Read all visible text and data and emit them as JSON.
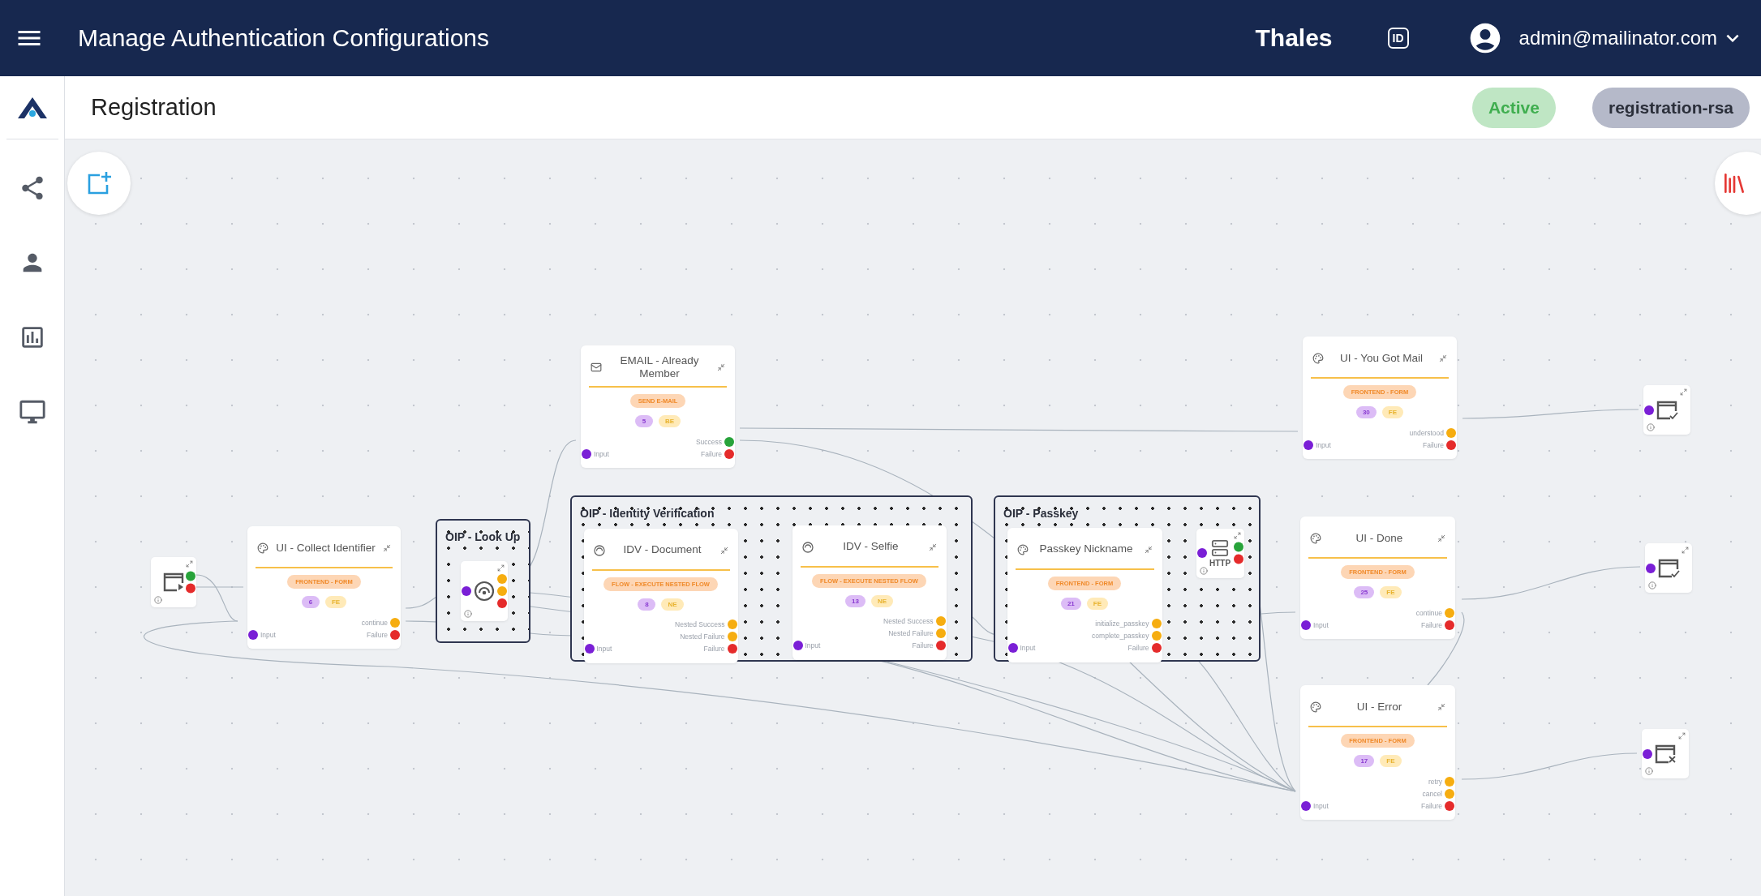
{
  "header": {
    "title": "Manage Authentication Configurations",
    "brand": "Thales",
    "id_badge": "ID",
    "user": "admin@mailinator.com"
  },
  "page": {
    "title": "Registration",
    "status": "Active",
    "flow_name": "registration-rsa"
  },
  "canvas": {
    "groups": [
      {
        "title": "OIP - Look Up"
      },
      {
        "title": "OIP - Identity Verification"
      },
      {
        "title": "OIP - Passkey"
      }
    ],
    "nodes": [
      {
        "kind": "start",
        "outputs": [
          {
            "kind": "success"
          },
          {
            "kind": "failure"
          }
        ]
      },
      {
        "kind": "form",
        "title": "UI - Collect Identifier",
        "type": "FRONTEND - FORM",
        "id": "6",
        "tag": "FE",
        "input_label": "Input",
        "outputs": [
          {
            "label": "continue",
            "kind": "outcome"
          },
          {
            "label": "Failure",
            "kind": "failure"
          }
        ]
      },
      {
        "kind": "lookup",
        "input": true,
        "outputs": [
          {
            "kind": "outcome"
          },
          {
            "kind": "outcome"
          },
          {
            "kind": "failure"
          }
        ]
      },
      {
        "kind": "email",
        "title": "EMAIL - Already Member",
        "type": "SEND E-MAIL",
        "id": "5",
        "tag": "BE",
        "input_label": "Input",
        "outputs": [
          {
            "label": "Success",
            "kind": "success"
          },
          {
            "label": "Failure",
            "kind": "failure"
          }
        ]
      },
      {
        "kind": "nested",
        "title": "IDV - Document",
        "type": "FLOW - EXECUTE NESTED FLOW",
        "id": "8",
        "tag": "NE",
        "input_label": "Input",
        "outputs": [
          {
            "label": "Nested Success",
            "kind": "outcome"
          },
          {
            "label": "Nested Failure",
            "kind": "outcome"
          },
          {
            "label": "Failure",
            "kind": "failure"
          }
        ]
      },
      {
        "kind": "nested",
        "title": "IDV - Selfie",
        "type": "FLOW - EXECUTE NESTED FLOW",
        "id": "13",
        "tag": "NE",
        "input_label": "Input",
        "outputs": [
          {
            "label": "Nested Success",
            "kind": "outcome"
          },
          {
            "label": "Nested Failure",
            "kind": "outcome"
          },
          {
            "label": "Failure",
            "kind": "failure"
          }
        ]
      },
      {
        "kind": "form",
        "title": "Passkey Nickname",
        "type": "FRONTEND - FORM",
        "id": "21",
        "tag": "FE",
        "input_label": "Input",
        "outputs": [
          {
            "label": "initialize_passkey",
            "kind": "outcome"
          },
          {
            "label": "complete_passkey",
            "kind": "outcome"
          },
          {
            "label": "Failure",
            "kind": "failure"
          }
        ]
      },
      {
        "kind": "http",
        "label": "HTTP",
        "input": true,
        "outputs": [
          {
            "kind": "success"
          },
          {
            "kind": "failure"
          }
        ]
      },
      {
        "kind": "form",
        "title": "UI - You Got Mail",
        "type": "FRONTEND - FORM",
        "id": "30",
        "tag": "FE",
        "input_label": "Input",
        "outputs": [
          {
            "label": "understood",
            "kind": "outcome"
          },
          {
            "label": "Failure",
            "kind": "failure"
          }
        ]
      },
      {
        "kind": "form",
        "title": "UI - Done",
        "type": "FRONTEND - FORM",
        "id": "25",
        "tag": "FE",
        "input_label": "Input",
        "outputs": [
          {
            "label": "continue",
            "kind": "outcome"
          },
          {
            "label": "Failure",
            "kind": "failure"
          }
        ]
      },
      {
        "kind": "form",
        "title": "UI - Error",
        "type": "FRONTEND - FORM",
        "id": "17",
        "tag": "FE",
        "input_label": "Input",
        "outputs": [
          {
            "label": "retry",
            "kind": "outcome"
          },
          {
            "label": "cancel",
            "kind": "outcome"
          },
          {
            "label": "Failure",
            "kind": "failure"
          }
        ]
      },
      {
        "kind": "end-success",
        "input": true
      },
      {
        "kind": "end-success",
        "input": true
      },
      {
        "kind": "end-error",
        "input": true
      }
    ]
  }
}
